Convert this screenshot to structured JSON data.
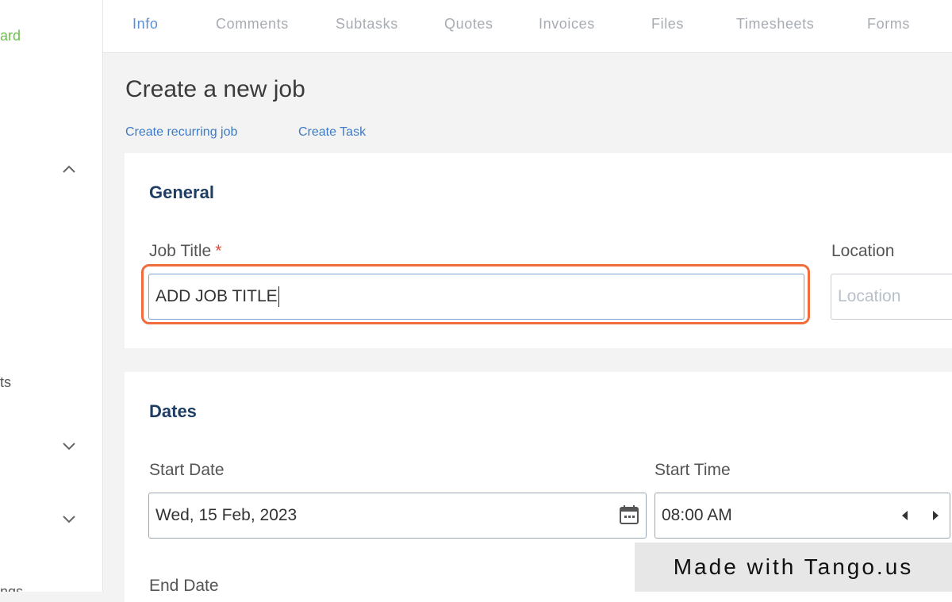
{
  "sidebar": {
    "active_item_fragment": "ard",
    "fragment_2": "ts",
    "fragment_3": "ngs"
  },
  "tabs": [
    {
      "label": "Info",
      "active": true
    },
    {
      "label": "Comments"
    },
    {
      "label": "Subtasks"
    },
    {
      "label": "Quotes"
    },
    {
      "label": "Invoices"
    },
    {
      "label": "Files"
    },
    {
      "label": "Timesheets"
    },
    {
      "label": "Forms"
    }
  ],
  "page": {
    "title": "Create a new job",
    "links": {
      "recurring": "Create recurring job",
      "task": "Create Task"
    }
  },
  "general": {
    "title": "General",
    "job_title_label": "Job Title",
    "required_mark": "*",
    "job_title_value": "ADD JOB TITLE",
    "location_label": "Location",
    "location_placeholder": "Location"
  },
  "dates": {
    "title": "Dates",
    "start_date_label": "Start Date",
    "start_date_value": "Wed, 15 Feb, 2023",
    "start_time_label": "Start Time",
    "start_time_value": "08:00 AM",
    "end_date_label": "End Date"
  },
  "watermark": "Made with Tango.us",
  "colors": {
    "accent_green": "#6cc04a",
    "tab_active": "#5b8fd3",
    "link": "#3e7bc4",
    "highlight": "#f26b3a",
    "section_title": "#1f3d63"
  }
}
